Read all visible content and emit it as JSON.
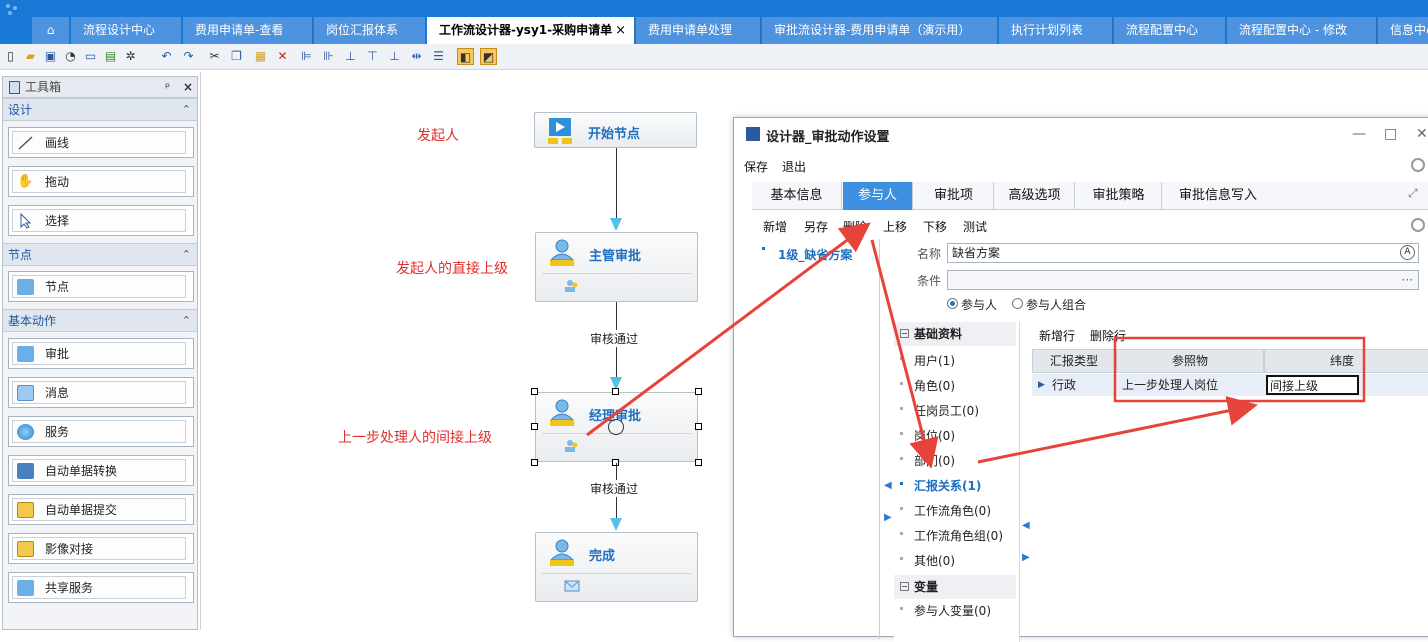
{
  "tabs": [
    {
      "label": "流程设计中心"
    },
    {
      "label": "费用申请单-查看"
    },
    {
      "label": "岗位汇报体系"
    },
    {
      "label": "工作流设计器-ysy1-采购申请单"
    },
    {
      "label": "费用申请单处理"
    },
    {
      "label": "审批流设计器-费用申请单（演示用）"
    },
    {
      "label": "执行计划列表"
    },
    {
      "label": "流程配置中心"
    },
    {
      "label": "流程配置中心 - 修改"
    },
    {
      "label": "信息中心"
    }
  ],
  "tab_close": "×",
  "toolbox": {
    "title": "工具箱",
    "pin": "ᵖ",
    "close": "×",
    "sections": [
      {
        "label": "设计",
        "items": [
          {
            "label": "画线",
            "icon": "line-icon"
          },
          {
            "label": "拖动",
            "icon": "hand-icon"
          },
          {
            "label": "选择",
            "icon": "cursor-icon"
          }
        ]
      },
      {
        "label": "节点",
        "items": [
          {
            "label": "节点",
            "icon": "person-icon"
          }
        ]
      },
      {
        "label": "基本动作",
        "items": [
          {
            "label": "审批",
            "icon": "approve-icon"
          },
          {
            "label": "消息",
            "icon": "mail-icon"
          },
          {
            "label": "服务",
            "icon": "globe-icon"
          },
          {
            "label": "自动单据转换",
            "icon": "convert-icon"
          },
          {
            "label": "自动单据提交",
            "icon": "submit-icon"
          },
          {
            "label": "影像对接",
            "icon": "image-icon"
          },
          {
            "label": "共享服务",
            "icon": "share-icon"
          }
        ]
      }
    ]
  },
  "canvas": {
    "annotations": [
      "发起人",
      "发起人的直接上级",
      "上一步处理人的间接上级"
    ],
    "nodes": [
      "开始节点",
      "主管审批",
      "经理审批",
      "完成"
    ],
    "flows": [
      "审核通过",
      "审核通过"
    ]
  },
  "dialog": {
    "title": "设计器_审批动作设置",
    "menu": [
      "保存",
      "退出"
    ],
    "tabs": [
      "基本信息",
      "参与人",
      "审批项",
      "高级选项",
      "审批策略",
      "审批信息写入"
    ],
    "actions": [
      "新增",
      "另存",
      "删除",
      "上移",
      "下移",
      "测试"
    ],
    "scheme": "1级_缺省方案",
    "name_label": "名称",
    "name_value": "缺省方案",
    "condition_label": "条件",
    "condition_btn": "···",
    "radio1": "参与人",
    "radio2": "参与人组合",
    "tree": {
      "group1": "基础资料",
      "items1": [
        "用户(1)",
        "角色(0)",
        "任岗员工(0)",
        "岗位(0)",
        "部门(0)",
        "汇报关系(1)",
        "工作流角色(0)",
        "工作流角色组(0)",
        "其他(0)"
      ],
      "group2": "变量",
      "items2": [
        "参与人变量(0)"
      ]
    },
    "grid": {
      "add_row": "新增行",
      "del_row": "删除行",
      "headers": [
        "汇报类型",
        "参照物",
        "纬度"
      ],
      "row": [
        "行政",
        "上一步处理人岗位",
        "间接上级"
      ]
    }
  },
  "colors": {
    "accent": "#1a78d6",
    "annotation": "#e0302b",
    "arrow": "#e8433a"
  }
}
